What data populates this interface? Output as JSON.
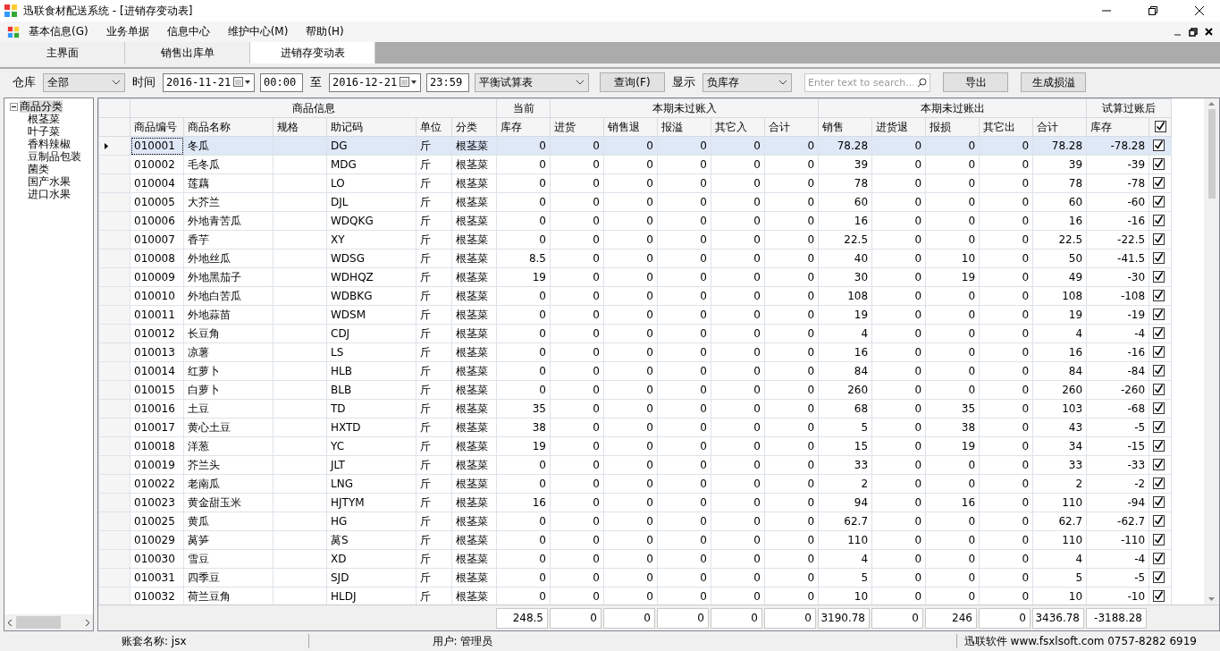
{
  "window": {
    "title": "迅联食材配送系统 - [进销存变动表]"
  },
  "menu": [
    "基本信息(G)",
    "业务单据",
    "信息中心",
    "维护中心(M)",
    "帮助(H)"
  ],
  "tabs": [
    {
      "label": "主界面",
      "selected": false
    },
    {
      "label": "销售出库单",
      "selected": false
    },
    {
      "label": "进销存变动表",
      "selected": true
    }
  ],
  "toolbar": {
    "warehouse_label": "仓库",
    "warehouse": "全部",
    "time_label": "时间",
    "start_date": "2016-11-21",
    "start_time": "00:00",
    "to_label": "至",
    "end_date": "2016-12-21",
    "end_time": "23:59",
    "report": "平衡试算表",
    "query_button": "查询(F)",
    "display_label": "显示",
    "display": "负库存",
    "search_placeholder": "Enter text to search...",
    "export_button": "导出",
    "generate_button": "生成损溢"
  },
  "tree": {
    "label": "商品分类",
    "expanded": true,
    "children": [
      {
        "label": "根茎菜"
      },
      {
        "label": "叶子菜"
      },
      {
        "label": "香料辣椒"
      },
      {
        "label": "豆制品包装"
      },
      {
        "label": "菌类"
      },
      {
        "label": "国产水果"
      },
      {
        "label": "进口水果"
      }
    ]
  },
  "table": {
    "groups": [
      {
        "label": "商品信息"
      },
      {
        "label": "当前"
      },
      {
        "label": "本期未过账入"
      },
      {
        "label": "本期未过账出"
      },
      {
        "label": "试算过账后"
      }
    ],
    "columns": [
      "商品编号",
      "商品名称",
      "规格",
      "助记码",
      "单位",
      "分类",
      "库存",
      "进货",
      "销售退",
      "报溢",
      "其它入",
      "合计",
      "销售",
      "进货退",
      "报损",
      "其它出",
      "合计",
      "库存"
    ],
    "header_checkbox": {
      "checked": true
    },
    "rows": [
      {
        "code": "010001",
        "name": "冬瓜",
        "mnemonic": "DG",
        "unit": "斤",
        "category": "根茎菜",
        "values": [
          "0",
          "0",
          "0",
          "0",
          "0",
          "0",
          "78.28",
          "0",
          "0",
          "0",
          "78.28",
          "-78.28"
        ],
        "checked": true,
        "selected": true
      },
      {
        "code": "010002",
        "name": "毛冬瓜",
        "mnemonic": "MDG",
        "unit": "斤",
        "category": "根茎菜",
        "values": [
          "0",
          "0",
          "0",
          "0",
          "0",
          "0",
          "39",
          "0",
          "0",
          "0",
          "39",
          "-39"
        ],
        "checked": true,
        "selected": false
      },
      {
        "code": "010004",
        "name": "莲藕",
        "mnemonic": "LO",
        "unit": "斤",
        "category": "根茎菜",
        "values": [
          "0",
          "0",
          "0",
          "0",
          "0",
          "0",
          "78",
          "0",
          "0",
          "0",
          "78",
          "-78"
        ],
        "checked": true,
        "selected": false
      },
      {
        "code": "010005",
        "name": "大芥兰",
        "mnemonic": "DJL",
        "unit": "斤",
        "category": "根茎菜",
        "values": [
          "0",
          "0",
          "0",
          "0",
          "0",
          "0",
          "60",
          "0",
          "0",
          "0",
          "60",
          "-60"
        ],
        "checked": true,
        "selected": false
      },
      {
        "code": "010006",
        "name": "外地青苦瓜",
        "mnemonic": "WDQKG",
        "unit": "斤",
        "category": "根茎菜",
        "values": [
          "0",
          "0",
          "0",
          "0",
          "0",
          "0",
          "16",
          "0",
          "0",
          "0",
          "16",
          "-16"
        ],
        "checked": true,
        "selected": false
      },
      {
        "code": "010007",
        "name": "香芋",
        "mnemonic": "XY",
        "unit": "斤",
        "category": "根茎菜",
        "values": [
          "0",
          "0",
          "0",
          "0",
          "0",
          "0",
          "22.5",
          "0",
          "0",
          "0",
          "22.5",
          "-22.5"
        ],
        "checked": true,
        "selected": false
      },
      {
        "code": "010008",
        "name": "外地丝瓜",
        "mnemonic": "WDSG",
        "unit": "斤",
        "category": "根茎菜",
        "values": [
          "8.5",
          "0",
          "0",
          "0",
          "0",
          "0",
          "40",
          "0",
          "10",
          "0",
          "50",
          "-41.5"
        ],
        "checked": true,
        "selected": false
      },
      {
        "code": "010009",
        "name": "外地黑茄子",
        "mnemonic": "WDHQZ",
        "unit": "斤",
        "category": "根茎菜",
        "values": [
          "19",
          "0",
          "0",
          "0",
          "0",
          "0",
          "30",
          "0",
          "19",
          "0",
          "49",
          "-30"
        ],
        "checked": true,
        "selected": false
      },
      {
        "code": "010010",
        "name": "外地白苦瓜",
        "mnemonic": "WDBKG",
        "unit": "斤",
        "category": "根茎菜",
        "values": [
          "0",
          "0",
          "0",
          "0",
          "0",
          "0",
          "108",
          "0",
          "0",
          "0",
          "108",
          "-108"
        ],
        "checked": true,
        "selected": false
      },
      {
        "code": "010011",
        "name": "外地蒜苗",
        "mnemonic": "WDSM",
        "unit": "斤",
        "category": "根茎菜",
        "values": [
          "0",
          "0",
          "0",
          "0",
          "0",
          "0",
          "19",
          "0",
          "0",
          "0",
          "19",
          "-19"
        ],
        "checked": true,
        "selected": false
      },
      {
        "code": "010012",
        "name": "长豆角",
        "mnemonic": "CDJ",
        "unit": "斤",
        "category": "根茎菜",
        "values": [
          "0",
          "0",
          "0",
          "0",
          "0",
          "0",
          "4",
          "0",
          "0",
          "0",
          "4",
          "-4"
        ],
        "checked": true,
        "selected": false
      },
      {
        "code": "010013",
        "name": "凉薯",
        "mnemonic": "LS",
        "unit": "斤",
        "category": "根茎菜",
        "values": [
          "0",
          "0",
          "0",
          "0",
          "0",
          "0",
          "16",
          "0",
          "0",
          "0",
          "16",
          "-16"
        ],
        "checked": true,
        "selected": false
      },
      {
        "code": "010014",
        "name": "红萝卜",
        "mnemonic": "HLB",
        "unit": "斤",
        "category": "根茎菜",
        "values": [
          "0",
          "0",
          "0",
          "0",
          "0",
          "0",
          "84",
          "0",
          "0",
          "0",
          "84",
          "-84"
        ],
        "checked": true,
        "selected": false
      },
      {
        "code": "010015",
        "name": "白萝卜",
        "mnemonic": "BLB",
        "unit": "斤",
        "category": "根茎菜",
        "values": [
          "0",
          "0",
          "0",
          "0",
          "0",
          "0",
          "260",
          "0",
          "0",
          "0",
          "260",
          "-260"
        ],
        "checked": true,
        "selected": false
      },
      {
        "code": "010016",
        "name": "土豆",
        "mnemonic": "TD",
        "unit": "斤",
        "category": "根茎菜",
        "values": [
          "35",
          "0",
          "0",
          "0",
          "0",
          "0",
          "68",
          "0",
          "35",
          "0",
          "103",
          "-68"
        ],
        "checked": true,
        "selected": false
      },
      {
        "code": "010017",
        "name": "黄心土豆",
        "mnemonic": "HXTD",
        "unit": "斤",
        "category": "根茎菜",
        "values": [
          "38",
          "0",
          "0",
          "0",
          "0",
          "0",
          "5",
          "0",
          "38",
          "0",
          "43",
          "-5"
        ],
        "checked": true,
        "selected": false
      },
      {
        "code": "010018",
        "name": "洋葱",
        "mnemonic": "YC",
        "unit": "斤",
        "category": "根茎菜",
        "values": [
          "19",
          "0",
          "0",
          "0",
          "0",
          "0",
          "15",
          "0",
          "19",
          "0",
          "34",
          "-15"
        ],
        "checked": true,
        "selected": false
      },
      {
        "code": "010019",
        "name": "芥兰头",
        "mnemonic": "JLT",
        "unit": "斤",
        "category": "根茎菜",
        "values": [
          "0",
          "0",
          "0",
          "0",
          "0",
          "0",
          "33",
          "0",
          "0",
          "0",
          "33",
          "-33"
        ],
        "checked": true,
        "selected": false
      },
      {
        "code": "010022",
        "name": "老南瓜",
        "mnemonic": "LNG",
        "unit": "斤",
        "category": "根茎菜",
        "values": [
          "0",
          "0",
          "0",
          "0",
          "0",
          "0",
          "2",
          "0",
          "0",
          "0",
          "2",
          "-2"
        ],
        "checked": true,
        "selected": false
      },
      {
        "code": "010023",
        "name": "黄金甜玉米",
        "mnemonic": "HJTYM",
        "unit": "斤",
        "category": "根茎菜",
        "values": [
          "16",
          "0",
          "0",
          "0",
          "0",
          "0",
          "94",
          "0",
          "16",
          "0",
          "110",
          "-94"
        ],
        "checked": true,
        "selected": false
      },
      {
        "code": "010025",
        "name": "黄瓜",
        "mnemonic": "HG",
        "unit": "斤",
        "category": "根茎菜",
        "values": [
          "0",
          "0",
          "0",
          "0",
          "0",
          "0",
          "62.7",
          "0",
          "0",
          "0",
          "62.7",
          "-62.7"
        ],
        "checked": true,
        "selected": false
      },
      {
        "code": "010029",
        "name": "莴笋",
        "mnemonic": "莴S",
        "unit": "斤",
        "category": "根茎菜",
        "values": [
          "0",
          "0",
          "0",
          "0",
          "0",
          "0",
          "110",
          "0",
          "0",
          "0",
          "110",
          "-110"
        ],
        "checked": true,
        "selected": false
      },
      {
        "code": "010030",
        "name": "雪豆",
        "mnemonic": "XD",
        "unit": "斤",
        "category": "根茎菜",
        "values": [
          "0",
          "0",
          "0",
          "0",
          "0",
          "0",
          "4",
          "0",
          "0",
          "0",
          "4",
          "-4"
        ],
        "checked": true,
        "selected": false
      },
      {
        "code": "010031",
        "name": "四季豆",
        "mnemonic": "SJD",
        "unit": "斤",
        "category": "根茎菜",
        "values": [
          "0",
          "0",
          "0",
          "0",
          "0",
          "0",
          "5",
          "0",
          "0",
          "0",
          "5",
          "-5"
        ],
        "checked": true,
        "selected": false
      },
      {
        "code": "010032",
        "name": "荷兰豆角",
        "mnemonic": "HLDJ",
        "unit": "斤",
        "category": "根茎菜",
        "values": [
          "0",
          "0",
          "0",
          "0",
          "0",
          "0",
          "10",
          "0",
          "0",
          "0",
          "10",
          "-10"
        ],
        "checked": true,
        "selected": false
      }
    ],
    "totals": [
      "248.5",
      "0",
      "0",
      "0",
      "0",
      "0",
      "3190.78",
      "0",
      "246",
      "0",
      "3436.78",
      "-3188.28"
    ]
  },
  "status_bar": {
    "account": "账套名称:  jsx",
    "user": "用户:  管理员",
    "company": "迅联软件  www.fsxlsoft.com 0757-8282 6919"
  }
}
